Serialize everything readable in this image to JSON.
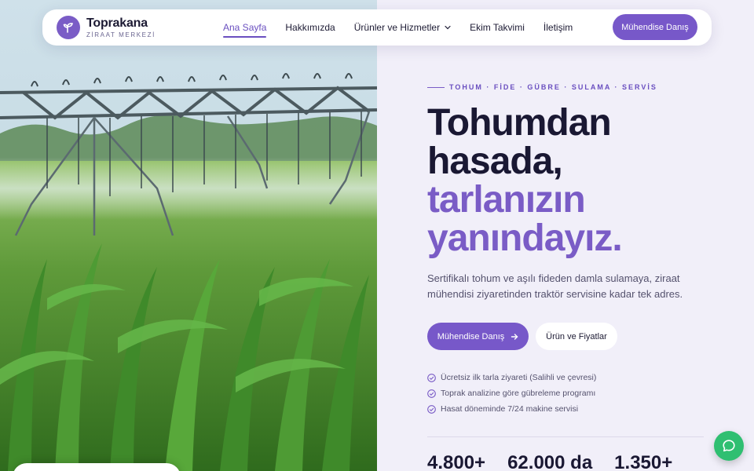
{
  "brand": {
    "name": "Toprakana",
    "subtitle": "ZİRAAT MERKEZİ",
    "logo_icon": "sprout-icon"
  },
  "nav": {
    "links": [
      {
        "label": "Ana Sayfa",
        "active": true
      },
      {
        "label": "Hakkımızda",
        "active": false
      },
      {
        "label": "Ürünler ve Hizmetler",
        "active": false,
        "dropdown": true
      },
      {
        "label": "Ekim Takvimi",
        "active": false
      },
      {
        "label": "İletişim",
        "active": false
      }
    ],
    "cta_label": "Mühendise Danış"
  },
  "hero": {
    "eyebrow": "TOHUM · FİDE · GÜBRE · SULAMA · SERVİS",
    "headline": [
      "Tohumdan",
      "hasada,",
      "tarlanızın",
      "yanındayız."
    ],
    "lead": "Sertifikalı tohum ve aşılı fideden damla sulamaya, ziraat mühendisi ziyaretinden traktör servisine kadar tek adres.",
    "primary_button": "Mühendise Danış",
    "secondary_button": "Ürün ve Fiyatlar",
    "features": [
      "Ücretsiz ilk tarla ziyareti (Salihli ve çevresi)",
      "Toprak analizine göre gübreleme programı",
      "Hasat döneminde 7/24 makine servisi"
    ],
    "stats": [
      "4.800+",
      "62.000 da",
      "1.350+"
    ]
  },
  "colors": {
    "accent": "#7758c9",
    "accent_text": "#7a5cc6",
    "dark": "#1a1833",
    "chat": "#2fbf71"
  },
  "icons": {
    "chat": "chat-bubble-icon",
    "check": "check-circle-icon",
    "arrow": "arrow-right-icon",
    "chevron": "chevron-down-icon"
  }
}
